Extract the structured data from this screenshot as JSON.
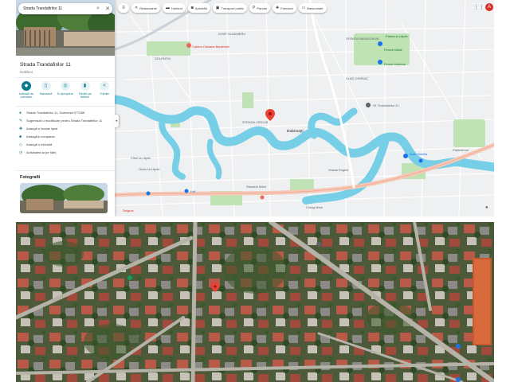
{
  "search": {
    "query": "Strada Trandafirilor 11"
  },
  "place": {
    "title": "Strada Trandafirilor 11",
    "subtitle": "Dobăroi"
  },
  "actions": [
    {
      "label": "Indicații de orientare",
      "icon": "directions-icon"
    },
    {
      "label": "Salvează",
      "icon": "bookmark-icon"
    },
    {
      "label": "În apropiere",
      "icon": "nearby-icon"
    },
    {
      "label": "Trimite pe telefon",
      "icon": "send-to-phone-icon"
    },
    {
      "label": "Trimite",
      "icon": "share-icon"
    }
  ],
  "info_rows": [
    {
      "text": "Strada Trandafirilor 11, Dobroești 077085",
      "icon": "location-pin-icon"
    },
    {
      "text": "Sugerează o modificare pentru Strada Trandafirilor 11",
      "icon": "pencil-icon"
    },
    {
      "text": "Adaugă o locație lipsă",
      "icon": "map-pin-plus-icon"
    },
    {
      "text": "Adaugă-ți compania",
      "icon": "business-icon"
    },
    {
      "text": "Adaugă o etichetă",
      "icon": "label-icon"
    },
    {
      "text": "Activitatea ta pe hărți",
      "icon": "history-icon"
    }
  ],
  "photos": {
    "heading": "Fotografii"
  },
  "chips": [
    {
      "label": "Restaurante",
      "icon": "fork-knife-icon"
    },
    {
      "label": "Hoteluri",
      "icon": "bed-icon"
    },
    {
      "label": "Activități",
      "icon": "camera-icon"
    },
    {
      "label": "Transport public",
      "icon": "bus-icon"
    },
    {
      "label": "Parcări",
      "icon": "parking-icon"
    },
    {
      "label": "Farmacii",
      "icon": "pharmacy-icon"
    },
    {
      "label": "Bancomate",
      "icon": "atm-icon"
    }
  ],
  "user": {
    "initial": "A"
  },
  "map_labels": [
    "IOSIF GLADMERU",
    "Cabina Casiana Bardeckă",
    "DOLENTIA",
    "Farma la Lăptic",
    "Fermă Hălcii",
    "Ferme Haluuwi",
    "Sf. Trandafirilor 21",
    "STRADA CIRCUȘ",
    "Dobroeşti",
    "Auto Mobilia",
    "Pantelimon",
    "Cirtel la Lăptic",
    "Ocolu la Lăptic",
    "Stradelu Mării",
    "SFÂNTA PARASCHIVA",
    "VLAD CHIRIAC",
    "Lidl",
    "Selgros",
    "Crâng Mare",
    "Strada Ruginii"
  ],
  "colors": {
    "accent": "#0b7a8e",
    "water": "#76cfe7",
    "land": "#f1f3f4",
    "park": "#bfe3b4",
    "road": "#ffffff",
    "highway": "#f8c7b5",
    "pin": "#ea4335"
  }
}
